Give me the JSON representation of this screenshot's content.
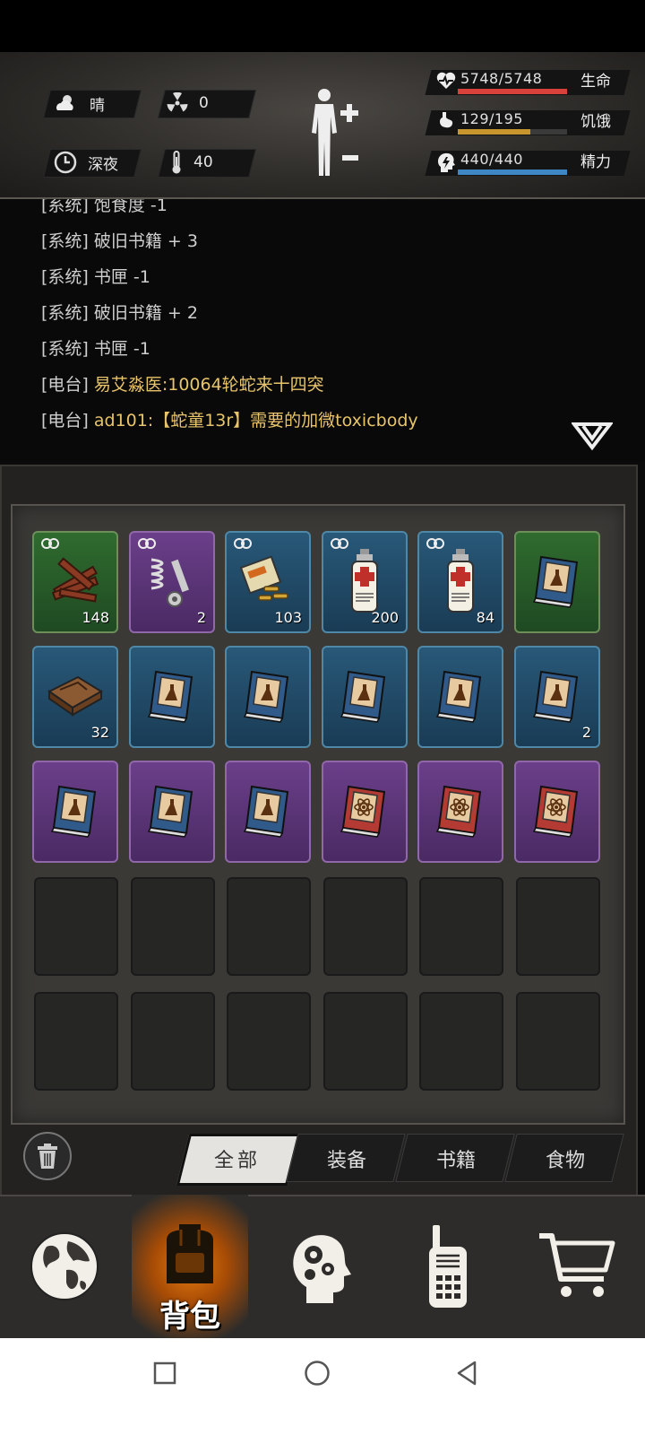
{
  "status": {
    "weather": "晴",
    "radiation": "0",
    "time_of_day": "深夜",
    "temperature": "40",
    "health": {
      "text": "5748/5748",
      "label": "生命",
      "fraction": 1.0,
      "color": "#d9423a"
    },
    "hunger": {
      "text": "129/195",
      "label": "饥饿",
      "fraction": 0.66,
      "color": "#c9962e"
    },
    "energy": {
      "text": "440/440",
      "label": "精力",
      "fraction": 1.0,
      "color": "#3f86c4"
    }
  },
  "log": [
    {
      "tag": "[系统]",
      "name": "",
      "msg": "饱食度 -1",
      "type": "system"
    },
    {
      "tag": "[系统]",
      "name": "",
      "msg": "破旧书籍 + 3",
      "type": "system"
    },
    {
      "tag": "[系统]",
      "name": "",
      "msg": "书匣 -1",
      "type": "system"
    },
    {
      "tag": "[系统]",
      "name": "",
      "msg": "破旧书籍 + 2",
      "type": "system"
    },
    {
      "tag": "[系统]",
      "name": "",
      "msg": "书匣 -1",
      "type": "system"
    },
    {
      "tag": "[电台]",
      "name": "",
      "msg": "易艾淼医:10064轮蛇来十四突",
      "type": "radio"
    },
    {
      "tag": "[电台]",
      "name": "",
      "msg": "ad101:【蛇童13r】需要的加微toxicbody",
      "type": "radio"
    }
  ],
  "inventory": [
    {
      "rarity": "green",
      "icon": "wood-planks-icon",
      "qty": "148",
      "locked": true
    },
    {
      "rarity": "purple",
      "icon": "spring-bolt-icon",
      "qty": "2",
      "locked": true
    },
    {
      "rarity": "blue",
      "icon": "ammo-box-icon",
      "qty": "103",
      "locked": true
    },
    {
      "rarity": "blue",
      "icon": "medical-spray-icon",
      "qty": "200",
      "locked": true
    },
    {
      "rarity": "blue",
      "icon": "medical-spray-icon",
      "qty": "84",
      "locked": true
    },
    {
      "rarity": "green",
      "icon": "chemistry-book-icon",
      "qty": "",
      "locked": false
    },
    {
      "rarity": "blue",
      "icon": "book-box-icon",
      "qty": "32",
      "locked": false
    },
    {
      "rarity": "blue",
      "icon": "chemistry-book-icon",
      "qty": "",
      "locked": false
    },
    {
      "rarity": "blue",
      "icon": "chemistry-book-icon",
      "qty": "",
      "locked": false
    },
    {
      "rarity": "blue",
      "icon": "chemistry-book-icon",
      "qty": "",
      "locked": false
    },
    {
      "rarity": "blue",
      "icon": "chemistry-book-icon",
      "qty": "",
      "locked": false
    },
    {
      "rarity": "blue",
      "icon": "chemistry-book-icon",
      "qty": "2",
      "locked": false
    },
    {
      "rarity": "purple",
      "icon": "chemistry-book-icon",
      "qty": "",
      "locked": false
    },
    {
      "rarity": "purple",
      "icon": "chemistry-book-icon",
      "qty": "",
      "locked": false
    },
    {
      "rarity": "purple",
      "icon": "chemistry-book-icon",
      "qty": "",
      "locked": false
    },
    {
      "rarity": "purple",
      "icon": "atom-book-icon",
      "qty": "",
      "locked": false
    },
    {
      "rarity": "purple",
      "icon": "atom-book-icon",
      "qty": "",
      "locked": false
    },
    {
      "rarity": "purple",
      "icon": "atom-book-icon",
      "qty": "",
      "locked": false
    }
  ],
  "empty_slots": 12,
  "filter_tabs": [
    "全部",
    "装备",
    "书籍",
    "食物"
  ],
  "active_tab": 0,
  "nav": {
    "items": [
      "globe-icon",
      "backpack-icon",
      "head-gears-icon",
      "radio-icon",
      "cart-icon"
    ],
    "active": 1,
    "active_label": "背包"
  },
  "system_bar": [
    "recent-apps-icon",
    "home-icon",
    "back-icon"
  ]
}
